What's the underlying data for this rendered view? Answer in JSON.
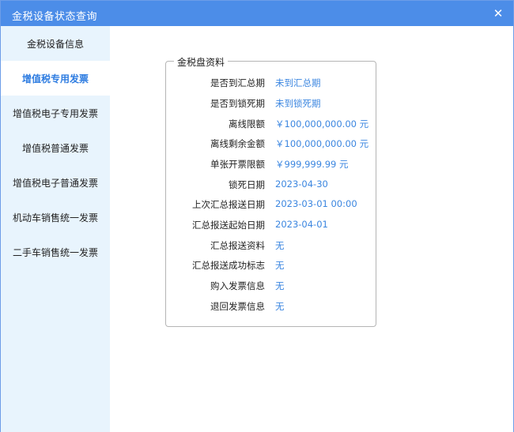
{
  "window": {
    "title": "金税设备状态查询",
    "close_glyph": "✕"
  },
  "sidebar": {
    "items": [
      {
        "label": "金税设备信息",
        "active": false
      },
      {
        "label": "增值税专用发票",
        "active": true
      },
      {
        "label": "增值税电子专用发票",
        "active": false
      },
      {
        "label": "增值税普通发票",
        "active": false
      },
      {
        "label": "增值税电子普通发票",
        "active": false
      },
      {
        "label": "机动车销售统一发票",
        "active": false
      },
      {
        "label": "二手车销售统一发票",
        "active": false
      }
    ]
  },
  "panel": {
    "title": "金税盘资料",
    "rows": [
      {
        "label": "是否到汇总期",
        "value": "未到汇总期"
      },
      {
        "label": "是否到锁死期",
        "value": "未到锁死期"
      },
      {
        "label": "离线限额",
        "value": "￥100,000,000.00 元"
      },
      {
        "label": "离线剩余金额",
        "value": "￥100,000,000.00 元"
      },
      {
        "label": "单张开票限额",
        "value": "￥999,999.99 元"
      },
      {
        "label": "锁死日期",
        "value": "2023-04-30"
      },
      {
        "label": "上次汇总报送日期",
        "value": "2023-03-01 00:00"
      },
      {
        "label": "汇总报送起始日期",
        "value": "2023-04-01"
      },
      {
        "label": "汇总报送资料",
        "value": "无"
      },
      {
        "label": "汇总报送成功标志",
        "value": "无"
      },
      {
        "label": "购入发票信息",
        "value": "无"
      },
      {
        "label": "退回发票信息",
        "value": "无"
      }
    ]
  },
  "colors": {
    "titlebar": "#4c8de8",
    "sidebar_bg": "#e8f4fd",
    "accent": "#2f7de1",
    "value_text": "#3b86e0"
  }
}
